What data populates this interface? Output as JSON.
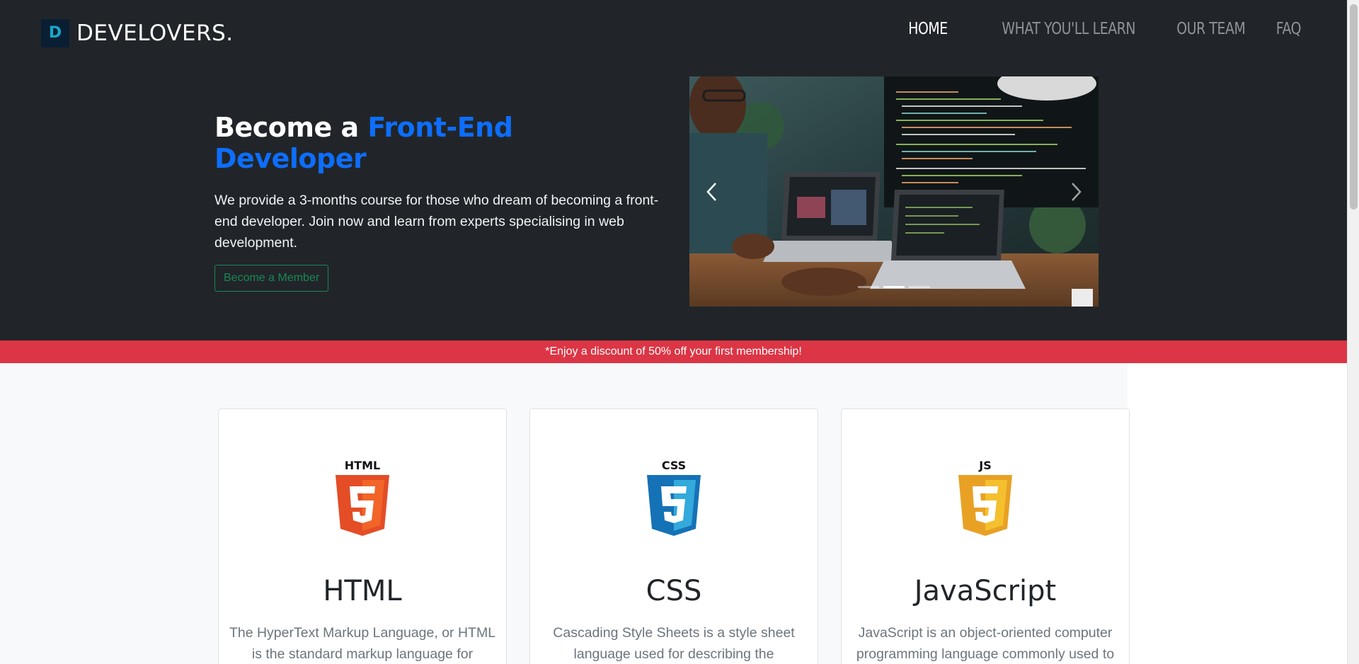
{
  "brand": {
    "logo_letter": "D",
    "name": "DEVELOVERS."
  },
  "nav": [
    {
      "label": "HOME",
      "active": true
    },
    {
      "label": "WHAT YOU'LL LEARN",
      "active": false
    },
    {
      "label": "OUR TEAM",
      "active": false
    },
    {
      "label": "FAQ",
      "active": false
    }
  ],
  "hero": {
    "title_prefix": "Become a ",
    "title_accent": "Front-End Developer",
    "description": "We provide a 3-months course for those who dream of becoming a front-end developer. Join now and learn from experts specialising in web development.",
    "cta_label": "Become a Member"
  },
  "carousel": {
    "slide_count": 3,
    "active_index": 1,
    "prev_icon": "chevron-left-icon",
    "next_icon": "chevron-right-icon"
  },
  "promo": {
    "text": "*Enjoy a discount of 50% off your first membership!"
  },
  "cards": [
    {
      "icon": "html5-icon",
      "badge": "HTML",
      "title": "HTML",
      "text": "The HyperText Markup Language, or HTML is the standard markup language for documents",
      "color": "#e44d26",
      "shade": "#f16529"
    },
    {
      "icon": "css3-icon",
      "badge": "CSS",
      "title": "CSS",
      "text": "Cascading Style Sheets is a style sheet language used for describing the presentation",
      "color": "#1572b6",
      "shade": "#33a9dc"
    },
    {
      "icon": "javascript-icon",
      "badge": "JS",
      "title": "JavaScript",
      "text": "JavaScript is an object-oriented computer programming language commonly used to",
      "color": "#e8a124",
      "shade": "#f5c02e"
    }
  ],
  "colors": {
    "hero_bg": "#212529",
    "accent": "#0d6efd",
    "promo_bg": "#dc3545",
    "member_button": "#198754"
  }
}
